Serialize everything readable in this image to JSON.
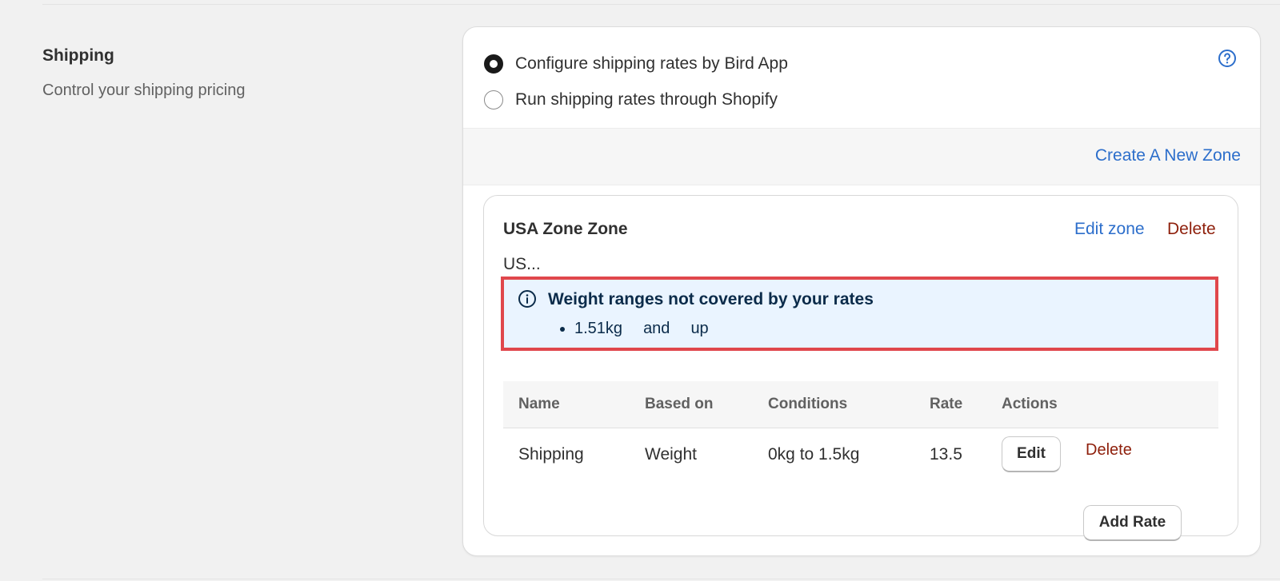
{
  "section": {
    "title": "Shipping",
    "description": "Control your shipping pricing"
  },
  "shipping_method": {
    "options": [
      {
        "label": "Configure shipping rates by Bird App",
        "selected": true
      },
      {
        "label": "Run shipping rates through Shopify",
        "selected": false
      }
    ],
    "help_icon": "question-circle-icon"
  },
  "zones_header": {
    "create_label": "Create A New Zone"
  },
  "zone": {
    "title": "USA Zone Zone",
    "edit_label": "Edit zone",
    "delete_label": "Delete",
    "countries": "US...",
    "warning": {
      "icon": "info-icon",
      "title": "Weight ranges not covered by your rates",
      "range": {
        "from": "1.51kg",
        "connector": "and",
        "to": "up"
      }
    },
    "table": {
      "headers": [
        "Name",
        "Based on",
        "Conditions",
        "Rate",
        "Actions"
      ],
      "rows": [
        {
          "name": "Shipping",
          "based_on": "Weight",
          "conditions": "0kg to 1.5kg",
          "rate": "13.5",
          "edit_label": "Edit",
          "delete_label": "Delete"
        }
      ]
    },
    "add_rate_label": "Add Rate"
  },
  "colors": {
    "link_blue": "#2c6ecb",
    "destructive": "#8e1f0b",
    "banner_bg": "#eaf4ff",
    "highlight_border": "#e0474c"
  }
}
